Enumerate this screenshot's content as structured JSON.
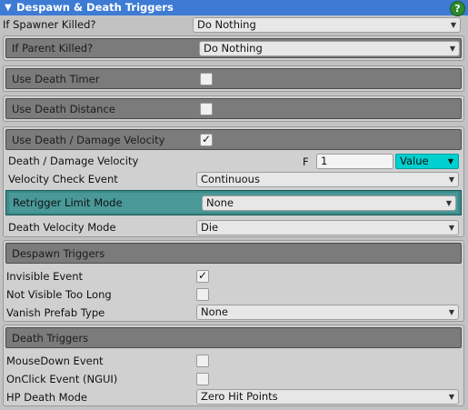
{
  "title": "Despawn & Death Triggers",
  "help_glyph": "?",
  "rows": {
    "if_spawner_killed": {
      "label": "If Spawner Killed?",
      "value": "Do Nothing"
    },
    "if_parent_killed": {
      "label": "If Parent Killed?",
      "value": "Do Nothing"
    },
    "use_death_timer": {
      "label": "Use Death Timer",
      "checked": false
    },
    "use_death_distance": {
      "label": "Use Death Distance",
      "checked": false
    },
    "use_death_velocity": {
      "label": "Use Death / Damage Velocity",
      "checked": true
    },
    "death_damage_velocity": {
      "label": "Death / Damage Velocity",
      "prefix": "F",
      "value": "1",
      "mode": "Value"
    },
    "velocity_check_event": {
      "label": "Velocity Check Event",
      "value": "Continuous"
    },
    "retrigger_limit_mode": {
      "label": "Retrigger Limit Mode",
      "value": "None"
    },
    "death_velocity_mode": {
      "label": "Death Velocity Mode",
      "value": "Die"
    }
  },
  "despawn_triggers": {
    "header": "Despawn Triggers",
    "invisible_event": {
      "label": "Invisible Event",
      "checked": true
    },
    "not_visible_too_long": {
      "label": "Not Visible Too Long",
      "checked": false
    },
    "vanish_prefab_type": {
      "label": "Vanish Prefab Type",
      "value": "None"
    }
  },
  "death_triggers": {
    "header": "Death Triggers",
    "mousedown_event": {
      "label": "MouseDown Event",
      "checked": false
    },
    "onclick_event": {
      "label": "OnClick Event (NGUI)",
      "checked": false
    },
    "hp_death_mode": {
      "label": "HP Death Mode",
      "value": "Zero Hit Points"
    }
  },
  "glyphs": {
    "dropdown_arrow": "▼",
    "checkmark": "✓",
    "foldout": "▼"
  },
  "colors": {
    "title_bar": "#3d7bd5",
    "teal_accent": "#00d0d0",
    "help": "#2d8a2d"
  }
}
